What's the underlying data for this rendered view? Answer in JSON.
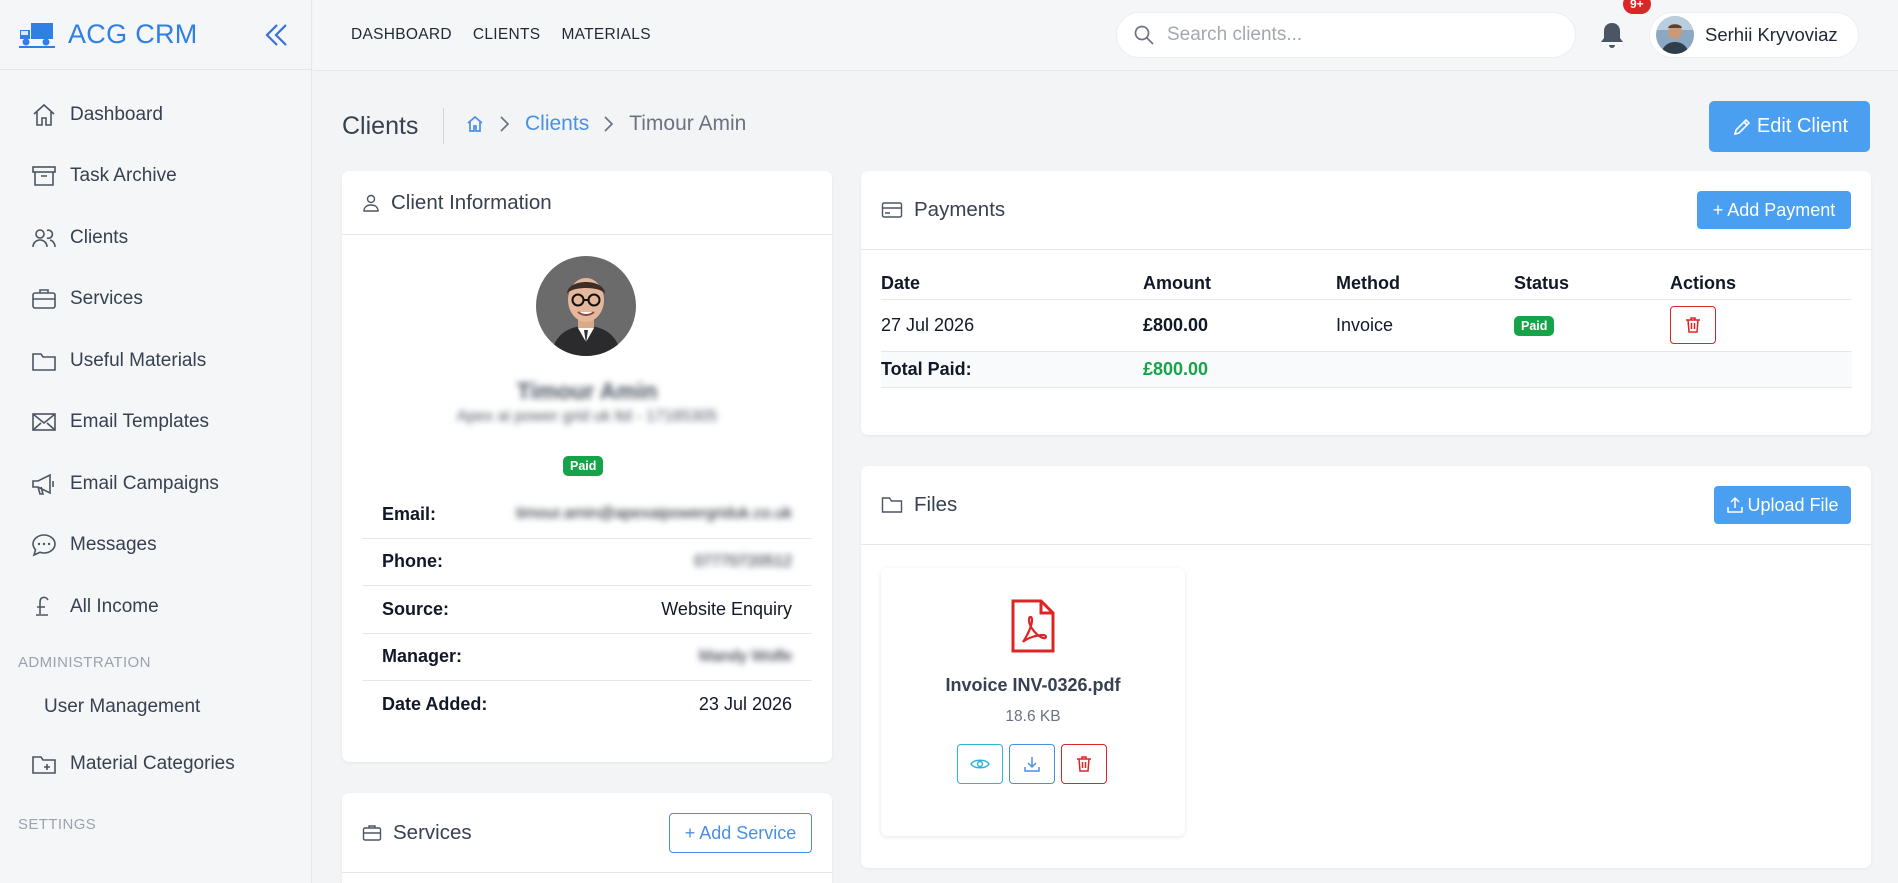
{
  "app": {
    "name": "ACG CRM"
  },
  "sidebar": {
    "items": [
      {
        "label": "Dashboard",
        "icon": "home-icon"
      },
      {
        "label": "Task Archive",
        "icon": "archive-icon"
      },
      {
        "label": "Clients",
        "icon": "users-icon"
      },
      {
        "label": "Services",
        "icon": "briefcase-icon"
      },
      {
        "label": "Useful Materials",
        "icon": "folder-icon"
      },
      {
        "label": "Email Templates",
        "icon": "mail-icon"
      },
      {
        "label": "Email Campaigns",
        "icon": "megaphone-icon"
      },
      {
        "label": "Messages",
        "icon": "chat-icon"
      },
      {
        "label": "All Income",
        "icon": "pound-icon"
      }
    ],
    "admin_section": "ADMINISTRATION",
    "admin_items": [
      {
        "label": "User Management"
      },
      {
        "label": "Material Categories",
        "icon": "folder-plus-icon"
      }
    ],
    "settings_section": "SETTINGS"
  },
  "topbar": {
    "links": [
      "DASHBOARD",
      "CLIENTS",
      "MATERIALS"
    ],
    "search_placeholder": "Search clients...",
    "notification_count": "9+",
    "user_name": "Serhii Kryvoviaz"
  },
  "page": {
    "title": "Clients",
    "breadcrumb": [
      "Clients",
      "Timour Amin"
    ],
    "edit_button": "Edit Client"
  },
  "client_info": {
    "title": "Client Information",
    "name": "Timour Amin",
    "company": "Apex ai power grid uk ltd - 17185305",
    "status": "Paid",
    "rows": [
      {
        "label": "Email:",
        "value": "timour.amin@apexaipowergriduk.co.uk"
      },
      {
        "label": "Phone:",
        "value": "07770720512"
      },
      {
        "label": "Source:",
        "value": "Website Enquiry"
      },
      {
        "label": "Manager:",
        "value": "Mandy Wolfe"
      },
      {
        "label": "Date Added:",
        "value": "23 Jul 2026"
      }
    ]
  },
  "payments": {
    "title": "Payments",
    "add_button": "+ Add Payment",
    "columns": [
      "Date",
      "Amount",
      "Method",
      "Status",
      "Actions"
    ],
    "rows": [
      {
        "date": "27 Jul 2026",
        "amount": "£800.00",
        "method": "Invoice",
        "status": "Paid"
      }
    ],
    "total_label": "Total Paid:",
    "total_value": "£800.00"
  },
  "files": {
    "title": "Files",
    "upload_button": "Upload File",
    "items": [
      {
        "name": "Invoice INV-0326.pdf",
        "size": "18.6 KB"
      }
    ]
  },
  "services": {
    "title": "Services",
    "add_button": "+ Add Service"
  },
  "colors": {
    "accent": "#4a9ff0",
    "brand": "#2f7fe4",
    "success": "#16a34a",
    "danger": "#dc2626"
  }
}
